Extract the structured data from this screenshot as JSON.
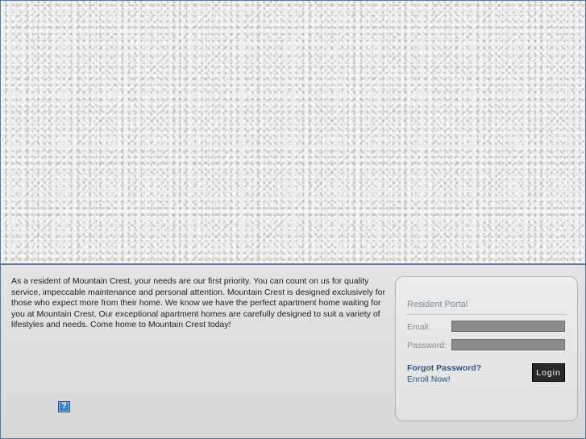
{
  "intro_text": "As a resident of Mountain Crest, your needs are our first priority. You can count on us for quality service, impeccable maintenance and personal attention. Mountain Crest is designed exclusively for those who expect more from their home. We know we have the perfect apartment home waiting for you at Mountain Crest. Our exceptional apartment homes are carefully designed to suit a variety of lifestyles and needs. Come home to Mountain Crest today!",
  "help": {
    "icon": "help-icon",
    "glyph": "?"
  },
  "portal": {
    "title": "Resident Portal",
    "email_label": "Email:",
    "email_value": "",
    "password_label": "Password:",
    "password_value": "",
    "forgot_link": "Forgot Password?",
    "enroll_link": "Enroll Now!",
    "login_button": "Login"
  },
  "colors": {
    "accent_border": "#5a7896",
    "link": "#2f557a",
    "button_bg": "#2a2a2a",
    "input_bg": "#8c8c8c"
  }
}
